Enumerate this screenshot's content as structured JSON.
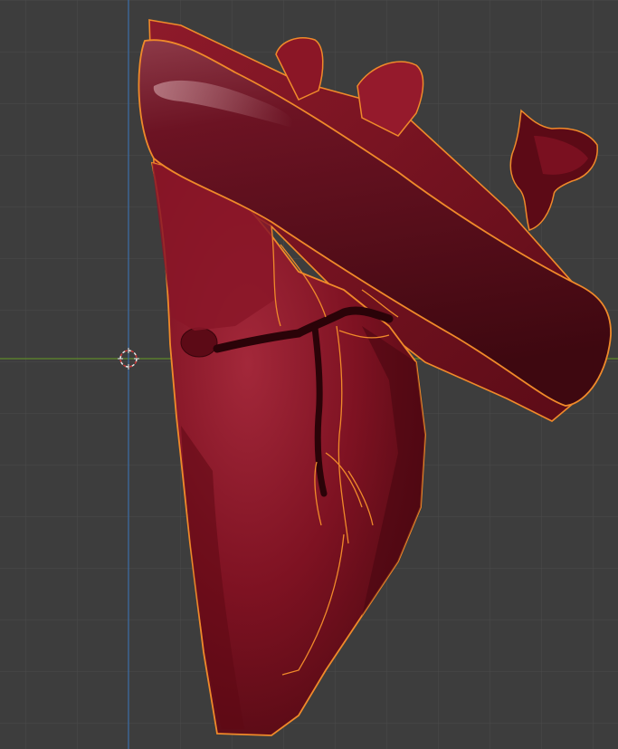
{
  "viewport": {
    "editor": "3D Viewport",
    "background_color": "#3d3d3d",
    "grid_color": "#4a4a4a",
    "x_axis_color": "#5f8a2a",
    "y_axis_color": "#3c6ea8",
    "selection_outline_color": "#f08a2a",
    "object_color": "#7a1020"
  },
  "icons": {
    "cursor": "3d-cursor-icon"
  },
  "scene": {
    "objects": [
      "heart",
      "aorta",
      "coronary-vessels",
      "atrial-appendage-fragment"
    ],
    "selected": true
  }
}
